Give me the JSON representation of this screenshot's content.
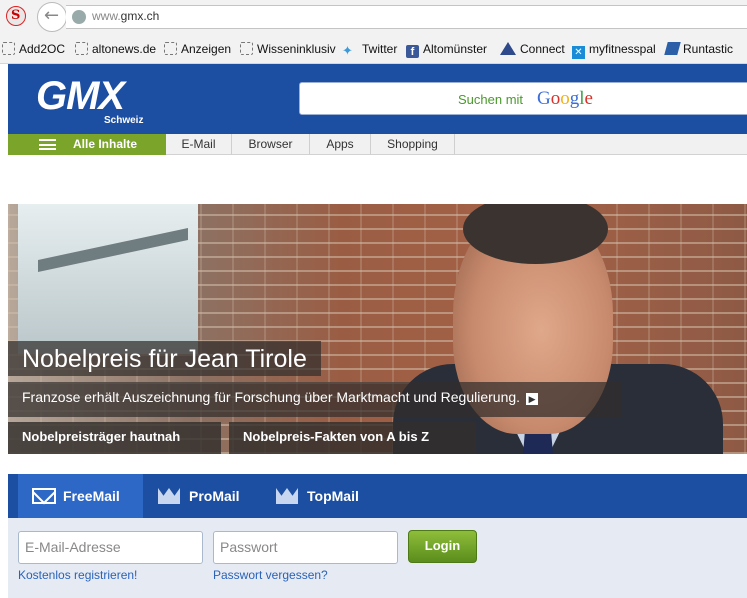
{
  "browser": {
    "url_host": "www.",
    "url_domain": "gmx.ch",
    "bookmarks": [
      {
        "label": "Add2OC",
        "icon": "dashed-square-icon"
      },
      {
        "label": "altonews.de",
        "icon": "dashed-square-icon"
      },
      {
        "label": "Anzeigen",
        "icon": "dashed-square-icon"
      },
      {
        "label": "Wisseninklusiv",
        "icon": "dashed-square-icon"
      },
      {
        "label": "Twitter",
        "icon": "twitter-icon"
      },
      {
        "label": "Altomünster",
        "icon": "facebook-icon"
      },
      {
        "label": "Connect",
        "icon": "triangle-icon"
      },
      {
        "label": "myfitnesspal",
        "icon": "myfitnesspal-icon"
      },
      {
        "label": "Runtastic",
        "icon": "runtastic-icon"
      }
    ]
  },
  "header": {
    "logo": "GMX",
    "logo_sub": "Schweiz",
    "search_label": "Suchen mit",
    "search_provider": "Google"
  },
  "nav": {
    "main": "Alle Inhalte",
    "items": [
      "E-Mail",
      "Browser",
      "Apps",
      "Shopping"
    ]
  },
  "hero": {
    "title": "Nobelpreis für Jean Tirole",
    "subtitle": "Franzose erhält Auszeichnung für Forschung über Marktmacht und Regulierung.",
    "buttons": [
      "Nobelpreisträger hautnah",
      "Nobelpreis-Fakten von A bis Z"
    ]
  },
  "mail": {
    "tabs": [
      "FreeMail",
      "ProMail",
      "TopMail"
    ],
    "email_placeholder": "E-Mail-Adresse",
    "password_placeholder": "Passwort",
    "login_label": "Login",
    "register_link": "Kostenlos registrieren!",
    "forgot_link": "Passwort vergessen?"
  },
  "colors": {
    "brand_blue": "#1c4ea1",
    "nav_green": "#7ba52a",
    "login_green": "#6a9e26"
  }
}
